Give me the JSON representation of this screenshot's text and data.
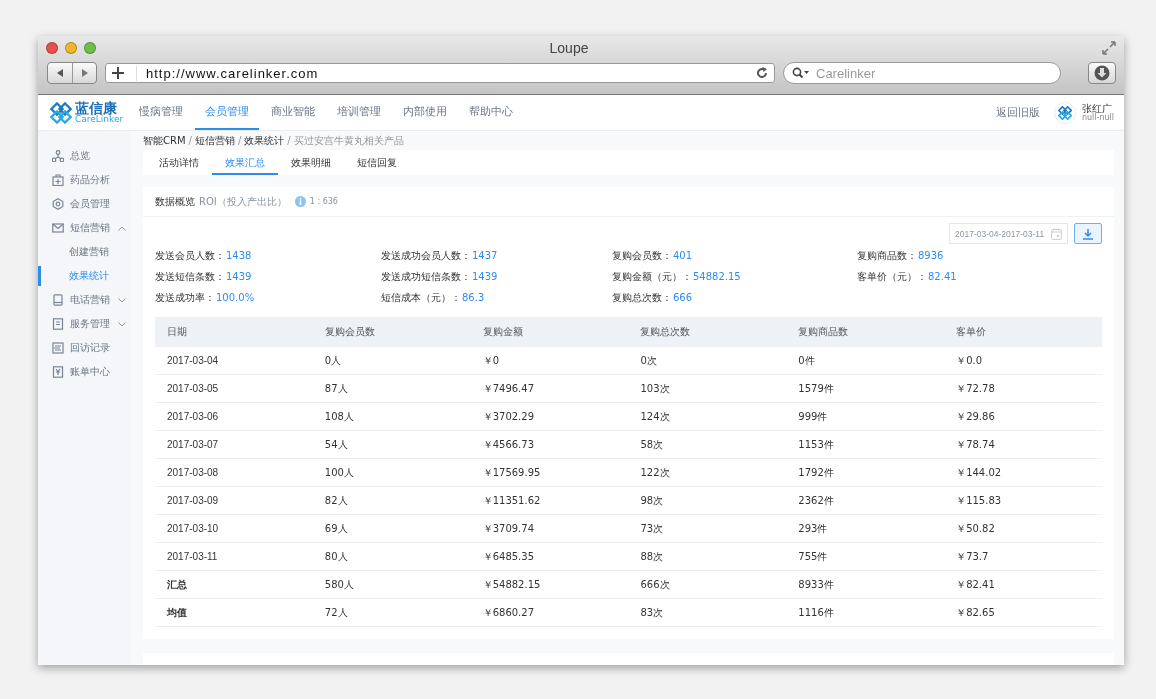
{
  "browser": {
    "title": "Loupe",
    "url": "http://www.carelinker.com",
    "search_placeholder": "Carelinker"
  },
  "header": {
    "logo_name": "蓝信康",
    "logo_sub": "CareLinker",
    "nav": [
      {
        "label": "慢病管理",
        "selected": false
      },
      {
        "label": "会员管理",
        "selected": true
      },
      {
        "label": "商业智能",
        "selected": false
      },
      {
        "label": "培训管理",
        "selected": false
      },
      {
        "label": "内部使用",
        "selected": false
      },
      {
        "label": "帮助中心",
        "selected": false
      }
    ],
    "back_link": "返回旧版",
    "user_name": "张红广",
    "user_sub": "null-null"
  },
  "sidebar": {
    "items": [
      {
        "label": "总览",
        "selected": false
      },
      {
        "label": "药品分析",
        "selected": false
      },
      {
        "label": "会员管理",
        "selected": false
      },
      {
        "label": "短信营销",
        "selected": false,
        "expanded": true,
        "children": [
          {
            "label": "创建营销",
            "selected": false
          },
          {
            "label": "效果统计",
            "selected": true
          }
        ]
      },
      {
        "label": "电话营销",
        "selected": false,
        "expanded": false
      },
      {
        "label": "服务管理",
        "selected": false,
        "expanded": false
      },
      {
        "label": "回访记录",
        "selected": false
      },
      {
        "label": "账单中心",
        "selected": false
      }
    ]
  },
  "breadcrumb": [
    {
      "label": "智能CRM",
      "separator": "/"
    },
    {
      "label": "短信营销",
      "separator": "/"
    },
    {
      "label": "效果统计",
      "separator": "/"
    },
    {
      "label": "买过安宫牛黄丸相关产品"
    }
  ],
  "tabs": [
    {
      "label": "活动详情",
      "selected": false
    },
    {
      "label": "效果汇总",
      "selected": true
    },
    {
      "label": "效果明细",
      "selected": false
    },
    {
      "label": "短信回复",
      "selected": false
    }
  ],
  "overview": {
    "title": "数据概览",
    "roi_label": "ROI（投入产出比）",
    "roi_value": "1 : 636",
    "date_range": "2017-03-04-2017-03-11",
    "stats": [
      [
        {
          "label": "发送会员人数：",
          "value": "1438"
        },
        {
          "label": "发送成功会员人数：",
          "value": "1437"
        },
        {
          "label": "复购会员数：",
          "value": "401"
        },
        {
          "label": "复购商品数：",
          "value": "8936"
        }
      ],
      [
        {
          "label": "发送短信条数：",
          "value": "1439"
        },
        {
          "label": "发送成功短信条数：",
          "value": "1439"
        },
        {
          "label": "复购金额（元）：",
          "value": "54882.15"
        },
        {
          "label": "客单价（元）：",
          "value": "82.41"
        }
      ],
      [
        {
          "label": "发送成功率：",
          "value": "100.0%"
        },
        {
          "label": "短信成本（元）：",
          "value": "86.3"
        },
        {
          "label": "复购总次数：",
          "value": "666"
        }
      ]
    ]
  },
  "table": {
    "columns": [
      "日期",
      "复购会员数",
      "复购金额",
      "复购总次数",
      "复购商品数",
      "客单价"
    ],
    "rows": [
      {
        "kind": "data",
        "cells": [
          "2017-03-04",
          "0人",
          "￥0",
          "0次",
          "0件",
          "￥0.0"
        ]
      },
      {
        "kind": "data",
        "cells": [
          "2017-03-05",
          "87人",
          "￥7496.47",
          "103次",
          "1579件",
          "￥72.78"
        ]
      },
      {
        "kind": "data",
        "cells": [
          "2017-03-06",
          "108人",
          "￥3702.29",
          "124次",
          "999件",
          "￥29.86"
        ]
      },
      {
        "kind": "data",
        "cells": [
          "2017-03-07",
          "54人",
          "￥4566.73",
          "58次",
          "1153件",
          "￥78.74"
        ]
      },
      {
        "kind": "data",
        "cells": [
          "2017-03-08",
          "100人",
          "￥17569.95",
          "122次",
          "1792件",
          "￥144.02"
        ]
      },
      {
        "kind": "data",
        "cells": [
          "2017-03-09",
          "82人",
          "￥11351.62",
          "98次",
          "2362件",
          "￥115.83"
        ]
      },
      {
        "kind": "data",
        "cells": [
          "2017-03-10",
          "69人",
          "￥3709.74",
          "73次",
          "293件",
          "￥50.82"
        ]
      },
      {
        "kind": "data",
        "cells": [
          "2017-03-11",
          "80人",
          "￥6485.35",
          "88次",
          "755件",
          "￥73.7"
        ]
      },
      {
        "kind": "summary",
        "cells": [
          "汇总",
          "580人",
          "￥54882.15",
          "666次",
          "8933件",
          "￥82.41"
        ]
      },
      {
        "kind": "summary",
        "cells": [
          "均值",
          "72人",
          "￥6860.27",
          "83次",
          "1116件",
          "￥82.65"
        ]
      }
    ]
  }
}
